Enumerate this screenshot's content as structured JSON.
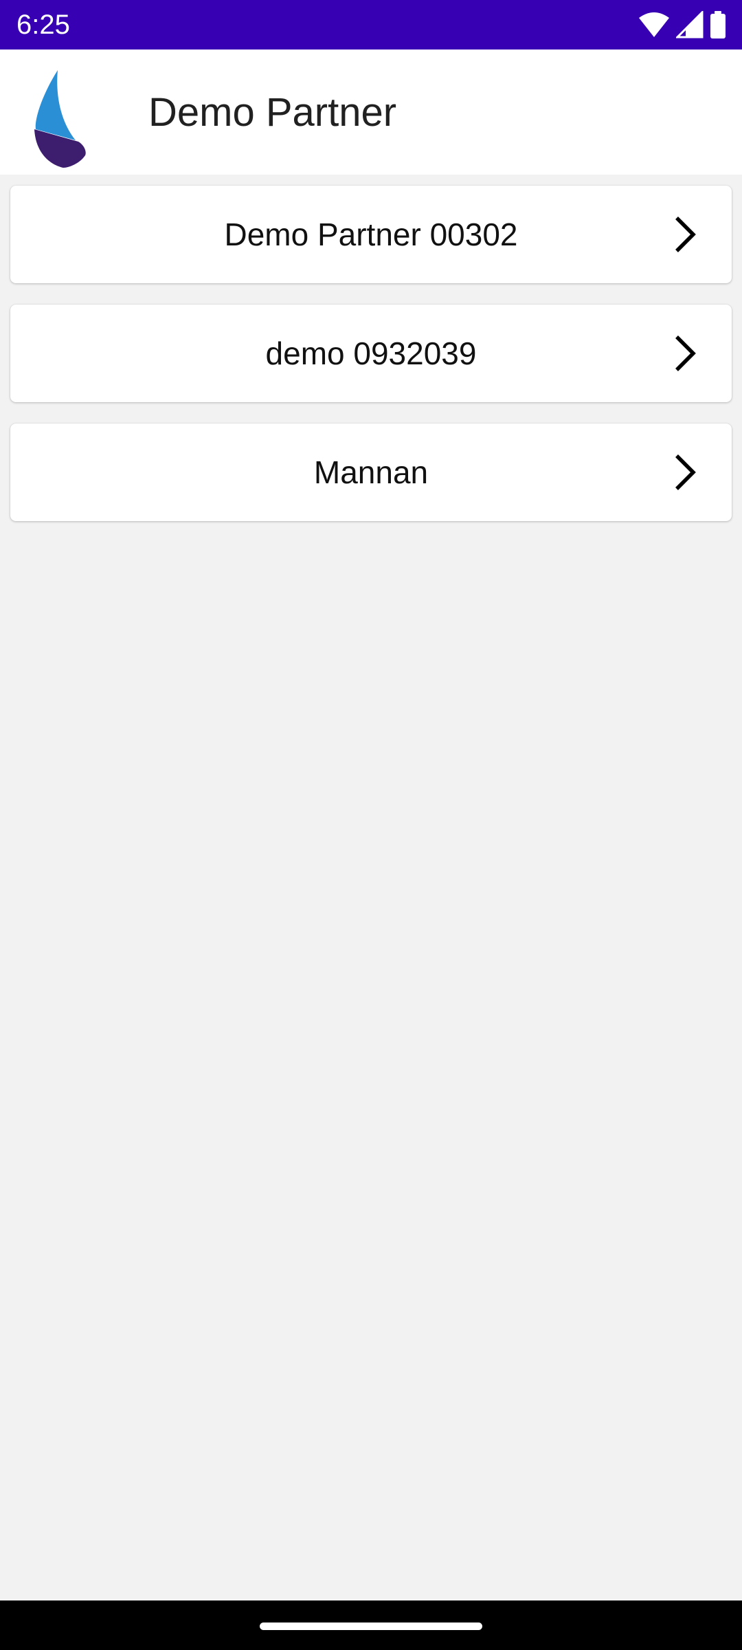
{
  "status_bar": {
    "time": "6:25",
    "background_color": "#3700b3",
    "icons": [
      "wifi-icon",
      "cellular-signal-icon",
      "battery-icon"
    ]
  },
  "app_bar": {
    "title": "Demo Partner",
    "logo": "sail-logo"
  },
  "partners": [
    {
      "name": "Demo Partner 00302",
      "icon": "chevron-right-icon"
    },
    {
      "name": "demo 0932039",
      "icon": "chevron-right-icon"
    },
    {
      "name": "Mannan",
      "icon": "chevron-right-icon"
    }
  ],
  "colors": {
    "accent": "#3700b3",
    "logo_blue": "#2b8fd6",
    "logo_purple": "#3d1d6e",
    "background": "#f2f2f2"
  }
}
